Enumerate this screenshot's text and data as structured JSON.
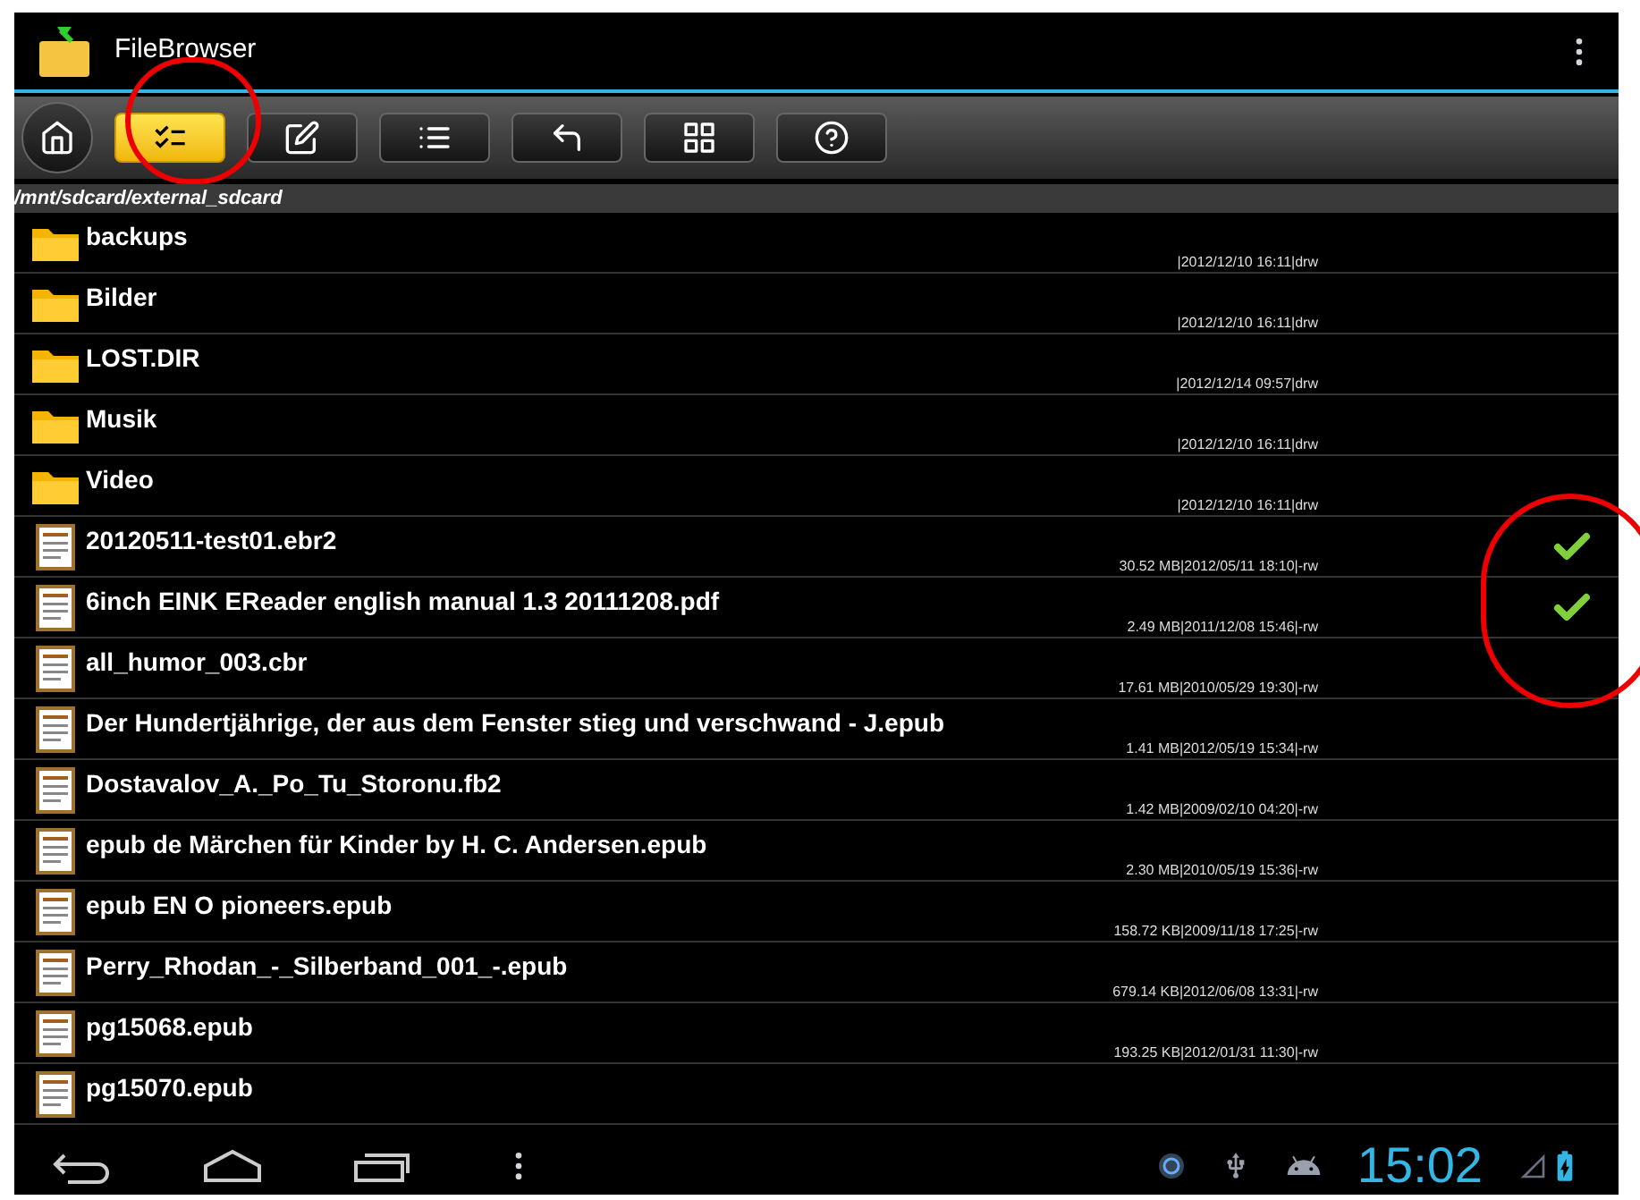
{
  "app_bar": {
    "title": "FileBrowser"
  },
  "toolbar": [
    {
      "kind": "home",
      "selected": false
    },
    {
      "kind": "multiselect",
      "selected": true
    },
    {
      "kind": "edit",
      "selected": false
    },
    {
      "kind": "list",
      "selected": false
    },
    {
      "kind": "back",
      "selected": false
    },
    {
      "kind": "grid",
      "selected": false
    },
    {
      "kind": "help",
      "selected": false
    }
  ],
  "path": "/mnt/sdcard/external_sdcard",
  "files": [
    {
      "kind": "folder",
      "name": "backups",
      "details": "|2012/12/10 16:11|drw",
      "checked": false
    },
    {
      "kind": "folder",
      "name": "Bilder",
      "details": "|2012/12/10 16:11|drw",
      "checked": false
    },
    {
      "kind": "folder",
      "name": "LOST.DIR",
      "details": "|2012/12/14 09:57|drw",
      "checked": false
    },
    {
      "kind": "folder",
      "name": "Musik",
      "details": "|2012/12/10 16:11|drw",
      "checked": false
    },
    {
      "kind": "folder",
      "name": "Video",
      "details": "|2012/12/10 16:11|drw",
      "checked": false
    },
    {
      "kind": "file",
      "name": "20120511-test01.ebr2",
      "details": "30.52 MB|2012/05/11 18:10|-rw",
      "checked": true
    },
    {
      "kind": "file",
      "name": "6inch EINK EReader english manual 1.3 20111208.pdf",
      "details": "2.49 MB|2011/12/08 15:46|-rw",
      "checked": true
    },
    {
      "kind": "file",
      "name": "all_humor_003.cbr",
      "details": "17.61 MB|2010/05/29 19:30|-rw",
      "checked": false
    },
    {
      "kind": "file",
      "name": "Der Hundertjährige, der aus dem Fenster stieg und verschwand - J.epub",
      "details": "1.41 MB|2012/05/19 15:34|-rw",
      "checked": false
    },
    {
      "kind": "file",
      "name": "Dostavalov_A._Po_Tu_Storonu.fb2",
      "details": "1.42 MB|2009/02/10 04:20|-rw",
      "checked": false
    },
    {
      "kind": "file",
      "name": "epub de Märchen für Kinder by H. C. Andersen.epub",
      "details": "2.30 MB|2010/05/19 15:36|-rw",
      "checked": false
    },
    {
      "kind": "file",
      "name": "epub EN O pioneers.epub",
      "details": "158.72 KB|2009/11/18 17:25|-rw",
      "checked": false
    },
    {
      "kind": "file",
      "name": "Perry_Rhodan_-_Silberband_001_-.epub",
      "details": "679.14 KB|2012/06/08 13:31|-rw",
      "checked": false
    },
    {
      "kind": "file",
      "name": "pg15068.epub",
      "details": "193.25 KB|2012/01/31 11:30|-rw",
      "checked": false
    },
    {
      "kind": "file",
      "name": "pg15070.epub",
      "checked": false
    }
  ],
  "status_bar": {
    "time": "15:02"
  }
}
